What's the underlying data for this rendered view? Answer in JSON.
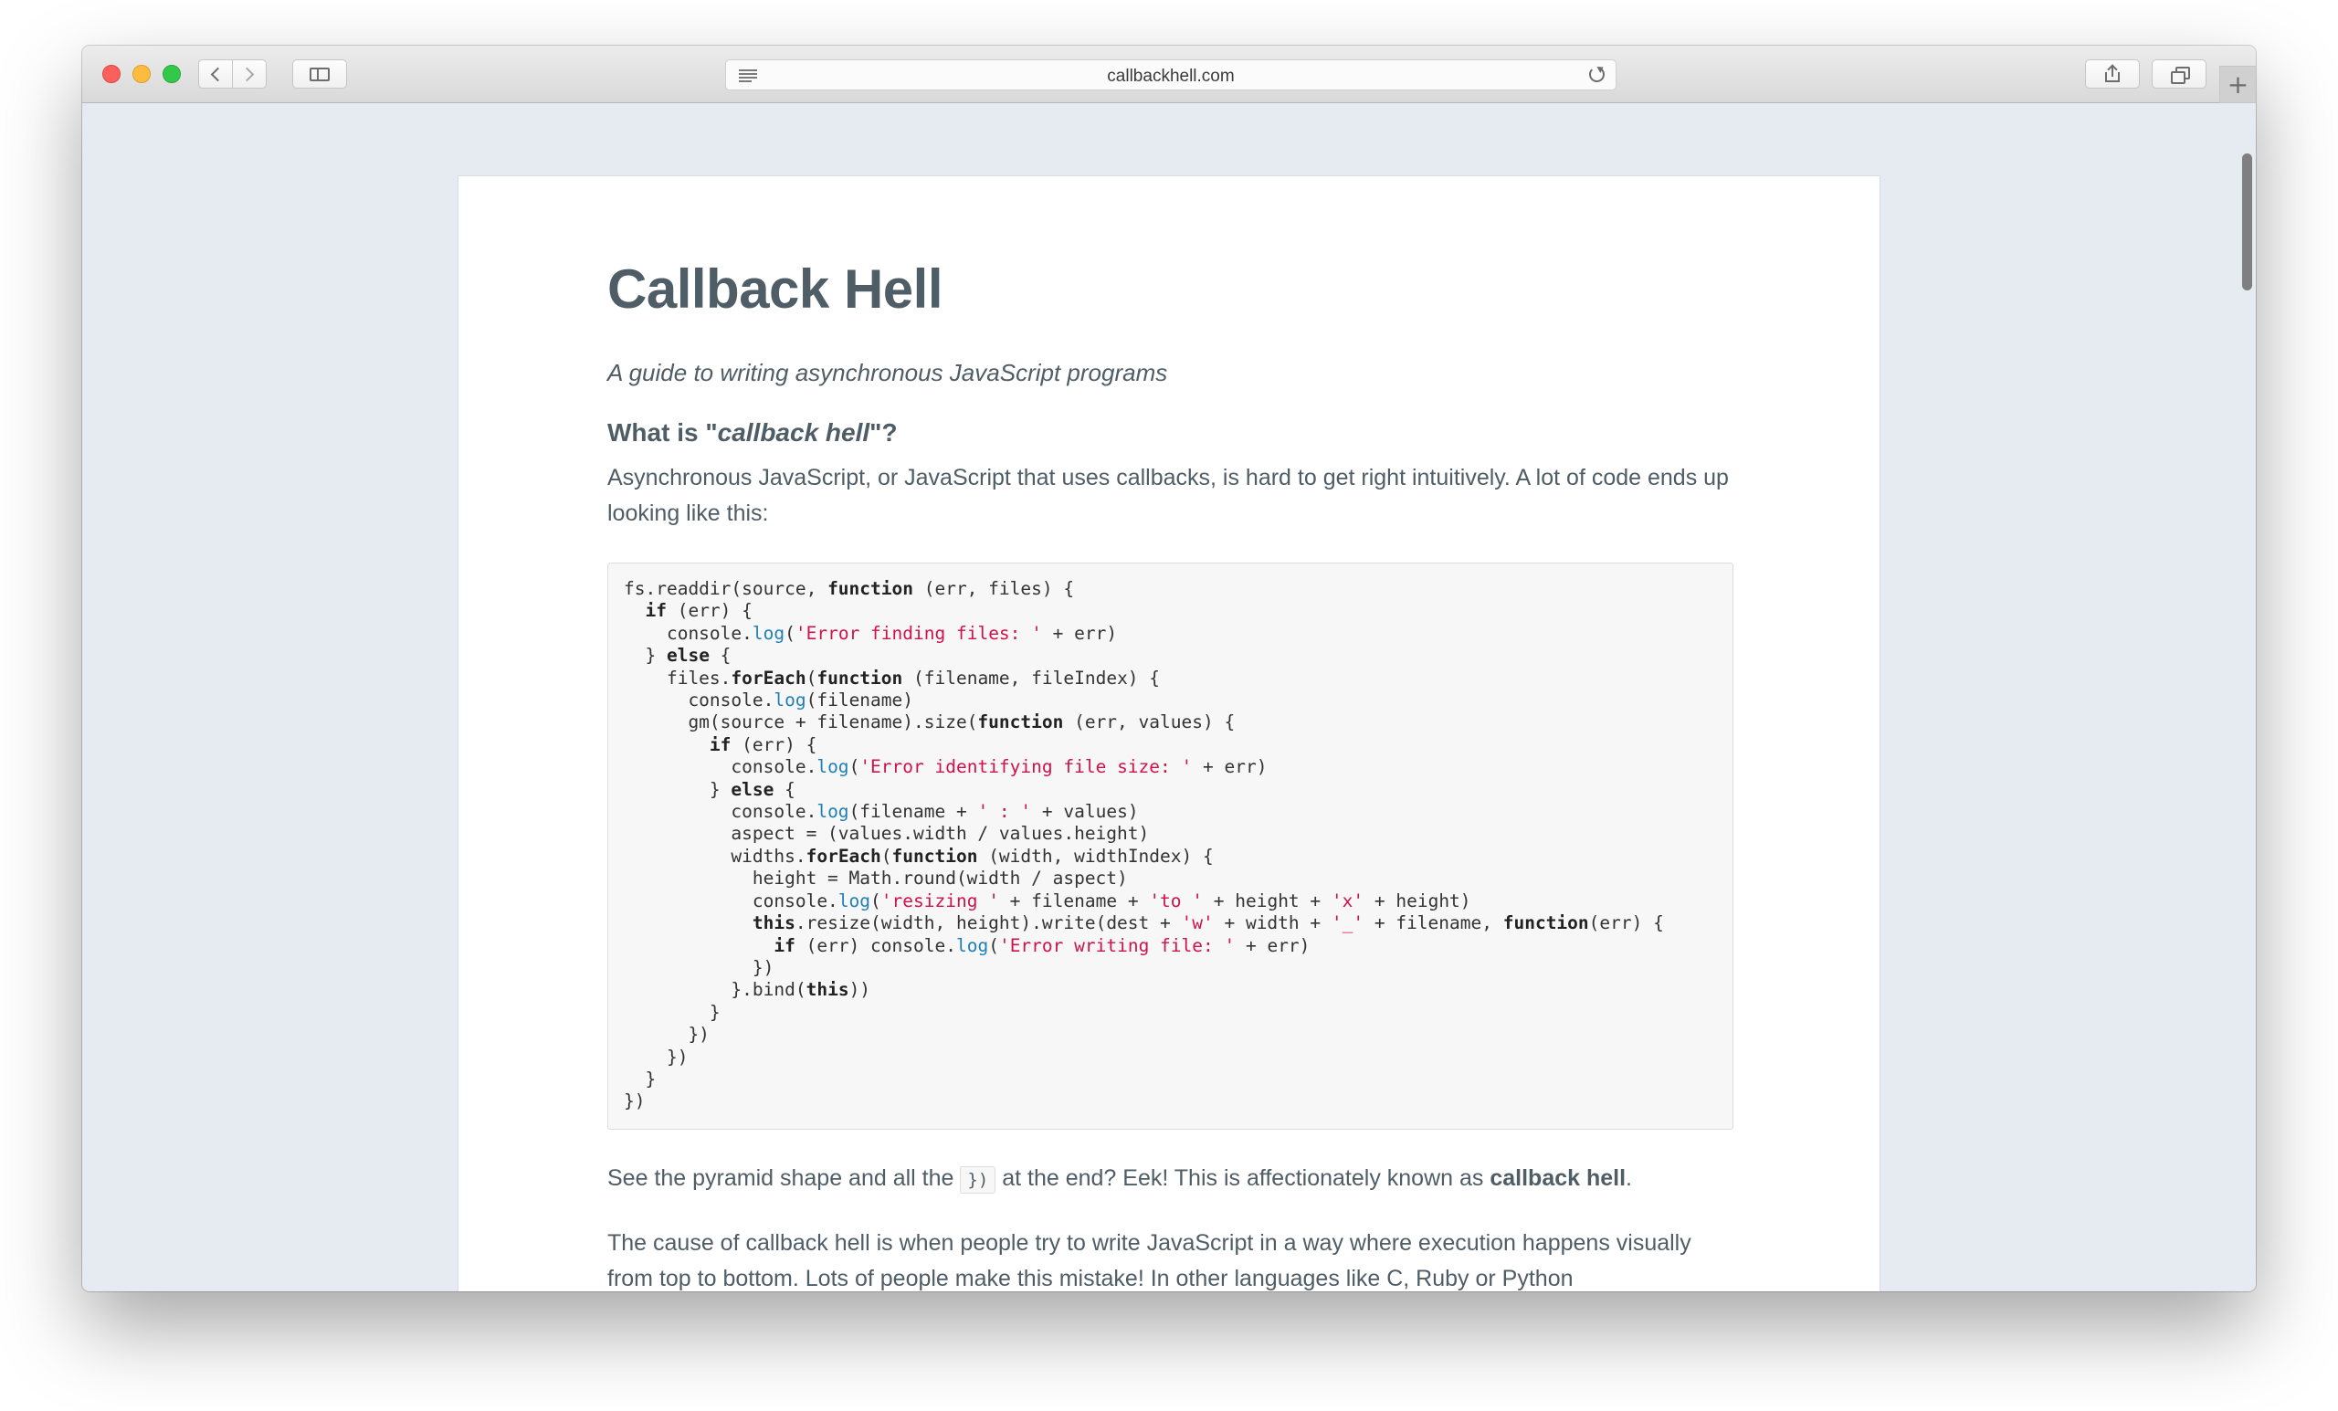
{
  "browser": {
    "url": "callbackhell.com"
  },
  "page": {
    "title": "Callback Hell",
    "subtitle": "A guide to writing asynchronous JavaScript programs",
    "section_heading_prefix": "What is \"",
    "section_heading_em": "callback hell",
    "section_heading_suffix": "\"?",
    "intro": "Asynchronous JavaScript, or JavaScript that uses callbacks, is hard to get right intuitively. A lot of code ends up looking like this:",
    "code_lines": [
      "fs.readdir(source, function (err, files) {",
      "  if (err) {",
      "    console.log('Error finding files: ' + err)",
      "  } else {",
      "    files.forEach(function (filename, fileIndex) {",
      "      console.log(filename)",
      "      gm(source + filename).size(function (err, values) {",
      "        if (err) {",
      "          console.log('Error identifying file size: ' + err)",
      "        } else {",
      "          console.log(filename + ' : ' + values)",
      "          aspect = (values.width / values.height)",
      "          widths.forEach(function (width, widthIndex) {",
      "            height = Math.round(width / aspect)",
      "            console.log('resizing ' + filename + 'to ' + height + 'x' + height)",
      "            this.resize(width, height).write(dest + 'w' + width + '_' + filename, function(err) {",
      "              if (err) console.log('Error writing file: ' + err)",
      "            })",
      "          }.bind(this))",
      "        }",
      "      })",
      "    })",
      "  }",
      "})"
    ],
    "pyramid_text_before": "See the pyramid shape and all the ",
    "pyramid_code": "})",
    "pyramid_text_middle": " at the end? Eek! This is affectionately known as ",
    "pyramid_strong": "callback hell",
    "pyramid_text_end": ".",
    "cause": "The cause of callback hell is when people try to write JavaScript in a way where execution happens visually from top to bottom. Lots of people make this mistake! In other languages like C, Ruby or Python"
  },
  "colors": {
    "keyword": "#222222",
    "method": "#1e7fb6",
    "string": "#d0124a",
    "text": "#4f5d66",
    "background": "#e5ebf0"
  }
}
